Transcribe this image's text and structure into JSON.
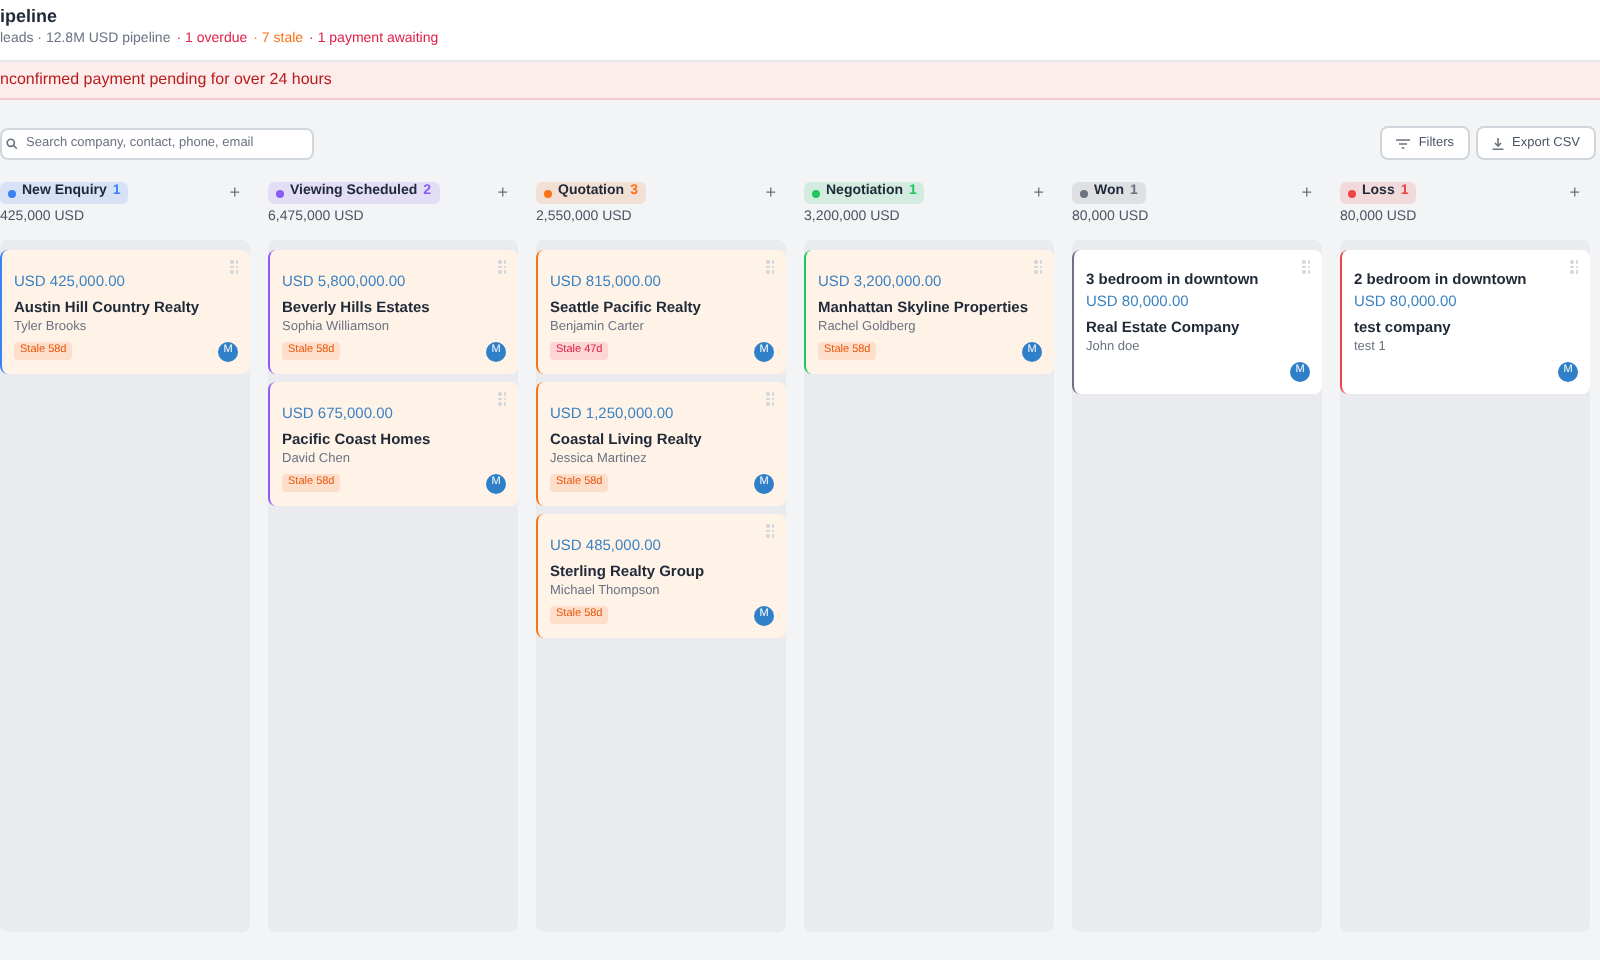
{
  "header": {
    "title": "ipeline",
    "summary": "leads · 12.8M USD pipeline",
    "alerts": [
      {
        "text": "· 1 overdue",
        "color": "#e11d48"
      },
      {
        "text": "· 7 stale",
        "color": "#f97316"
      },
      {
        "text": "· 1 payment awaiting",
        "color": "#e11d48"
      }
    ]
  },
  "banner": "nconfirmed payment pending for over 24 hours",
  "search": {
    "placeholder": "Search company, contact, phone, email"
  },
  "buttons": [
    "Filters",
    "Export CSV"
  ],
  "columns": [
    {
      "name": "New Enquiry",
      "count": "1",
      "color": "#3b82f6",
      "add": "+",
      "total": "425,000 USD",
      "cards": [
        {
          "kind": "deal",
          "amount": "USD 425,000.00",
          "company": "Austin Hill Country Realty",
          "contact": "Tyler Brooks",
          "badge": {
            "text": "Stale 58d",
            "color": "#ea580c"
          },
          "avatar": "M"
        }
      ]
    },
    {
      "name": "Viewing Scheduled",
      "count": "2",
      "color": "#8b5cf6",
      "add": "+",
      "total": "6,475,000 USD",
      "cards": [
        {
          "kind": "deal",
          "amount": "USD 5,800,000.00",
          "company": "Beverly Hills Estates",
          "contact": "Sophia Williamson",
          "badge": {
            "text": "Stale 58d",
            "color": "#ea580c"
          },
          "avatar": "M"
        },
        {
          "kind": "deal",
          "amount": "USD 675,000.00",
          "company": "Pacific Coast Homes",
          "contact": "David Chen",
          "badge": {
            "text": "Stale 58d",
            "color": "#ea580c"
          },
          "avatar": "M"
        }
      ]
    },
    {
      "name": "Quotation",
      "count": "3",
      "color": "#f97316",
      "add": "+",
      "total": "2,550,000 USD",
      "cards": [
        {
          "kind": "deal",
          "amount": "USD 815,000.00",
          "company": "Seattle Pacific Realty",
          "contact": "Benjamin Carter",
          "badge": {
            "text": "Stale 47d",
            "color": "#e11d48"
          },
          "avatar": "M"
        },
        {
          "kind": "deal",
          "amount": "USD 1,250,000.00",
          "company": "Coastal Living Realty",
          "contact": "Jessica Martinez",
          "badge": {
            "text": "Stale 58d",
            "color": "#ea580c"
          },
          "avatar": "M"
        },
        {
          "kind": "deal",
          "amount": "USD 485,000.00",
          "company": "Sterling Realty Group",
          "contact": "Michael Thompson",
          "badge": {
            "text": "Stale 58d",
            "color": "#ea580c"
          },
          "avatar": "M"
        }
      ]
    },
    {
      "name": "Negotiation",
      "count": "1",
      "color": "#22c55e",
      "add": "+",
      "total": "3,200,000 USD",
      "cards": [
        {
          "kind": "deal",
          "amount": "USD 3,200,000.00",
          "company": "Manhattan Skyline Properties",
          "contact": "Rachel Goldberg",
          "badge": {
            "text": "Stale 58d",
            "color": "#ea580c"
          },
          "avatar": "M"
        }
      ]
    },
    {
      "name": "Won",
      "count": "1",
      "color": "#6b7280",
      "add": "+",
      "total": "80,000 USD",
      "cards": [
        {
          "kind": "titled",
          "title": "3 bedroom in downtown",
          "amount": "USD 80,000.00",
          "company": "Real Estate Company",
          "contact": "John doe",
          "avatar": "M"
        }
      ]
    },
    {
      "name": "Loss",
      "count": "1",
      "color": "#ef4444",
      "add": "+",
      "total": "80,000 USD",
      "cards": [
        {
          "kind": "titled",
          "title": "2 bedroom in downtown",
          "amount": "USD 80,000.00",
          "company": "test company",
          "contact": "test 1",
          "avatar": "M"
        }
      ]
    }
  ]
}
